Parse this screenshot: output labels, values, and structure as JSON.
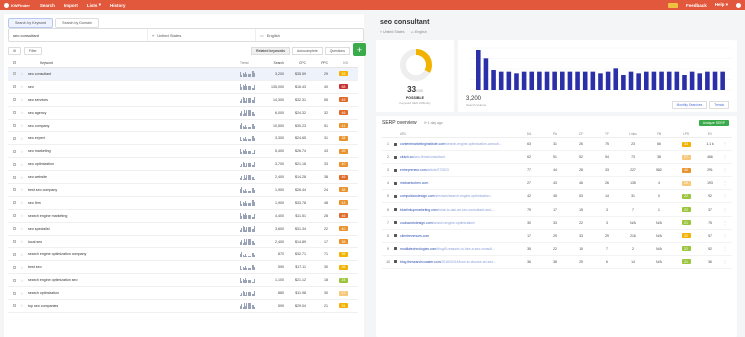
{
  "topbar": {
    "app_name": "KWFinder",
    "nav": [
      "Search",
      "Import",
      "Lists",
      "History"
    ],
    "lists_badge": "▾",
    "feedback": "Feedback",
    "help": "Help ▾"
  },
  "left": {
    "source_tabs": [
      "Search by Keyword",
      "Search by Domain"
    ],
    "keyword_value": "seo consultant",
    "location": "United States",
    "language": "English",
    "go_label": "+",
    "filter_label": "Filter",
    "kw_tabs": [
      "Related keywords",
      "Autocomplete",
      "Questions"
    ],
    "columns": {
      "keyword": "Keyword",
      "trend": "Trend",
      "search": "Search",
      "cpc": "CPC",
      "ppc": "PPC",
      "kd": "KD"
    },
    "rows": [
      {
        "kw": "seo consultant",
        "search": "3,200",
        "cpc": "$35.59",
        "ppc": "29",
        "kd": "33"
      },
      {
        "kw": "seo",
        "search": "135,000",
        "cpc": "$16.43",
        "ppc": "40",
        "kd": "58"
      },
      {
        "kw": "seo services",
        "search": "14,300",
        "cpc": "$32.31",
        "ppc": "55",
        "kd": "49"
      },
      {
        "kw": "seo agency",
        "search": "6,000",
        "cpc": "$24.32",
        "ppc": "32",
        "kd": "46"
      },
      {
        "kw": "seo company",
        "search": "10,500",
        "cpc": "$30.23",
        "ppc": "51",
        "kd": "41"
      },
      {
        "kw": "seo expert",
        "search": "3,300",
        "cpc": "$24.65",
        "ppc": "31",
        "kd": "38"
      },
      {
        "kw": "seo marketing",
        "search": "5,400",
        "cpc": "$26.74",
        "ppc": "43",
        "kd": "39"
      },
      {
        "kw": "seo optimization",
        "search": "3,700",
        "cpc": "$21.16",
        "ppc": "33",
        "kd": "40"
      },
      {
        "kw": "seo website",
        "search": "2,400",
        "cpc": "$14.28",
        "ppc": "38",
        "kd": "46"
      },
      {
        "kw": "best seo company",
        "search": "1,900",
        "cpc": "$26.44",
        "ppc": "24",
        "kd": "38"
      },
      {
        "kw": "seo firm",
        "search": "1,900",
        "cpc": "$33.78",
        "ppc": "48",
        "kd": "43"
      },
      {
        "kw": "search engine marketing",
        "search": "4,400",
        "cpc": "$11.51",
        "ppc": "28",
        "kd": "46"
      },
      {
        "kw": "seo specialist",
        "search": "3,600",
        "cpc": "$31.34",
        "ppc": "22",
        "kd": "40"
      },
      {
        "kw": "local seo",
        "search": "2,400",
        "cpc": "$14.89",
        "ppc": "17",
        "kd": "38"
      },
      {
        "kw": "search engine optimization company",
        "search": "870",
        "cpc": "$32.71",
        "ppc": "71",
        "kd": "35"
      },
      {
        "kw": "best seo",
        "search": "590",
        "cpc": "$17.11",
        "ppc": "30",
        "kd": "36"
      },
      {
        "kw": "search engine optimization seo",
        "search": "1,100",
        "cpc": "$21.12",
        "ppc": "18",
        "kd": "24"
      },
      {
        "kw": "search optimization",
        "search": "880",
        "cpc": "$11.98",
        "ppc": "30",
        "kd": "27"
      },
      {
        "kw": "top seo companies",
        "search": "590",
        "cpc": "$29.04",
        "ppc": "21",
        "kd": "31"
      }
    ]
  },
  "right": {
    "keyword_title": "seo consultant",
    "location": "United States",
    "language": "English",
    "kd_value": "33",
    "kd_max": "/100",
    "kd_label": "POSSIBLE",
    "kd_sub": "Keyword SEO Difficulty",
    "search_volume": "3,200",
    "search_volume_label": "Search Volume",
    "sv_buttons": [
      "Monthly Searches",
      "Trends"
    ],
    "sv_values": [
      96,
      76,
      48,
      44,
      44,
      40,
      44,
      44,
      44,
      44,
      44,
      44,
      44,
      44,
      44,
      44,
      40,
      44,
      52,
      36,
      44,
      40,
      44,
      44,
      44,
      44,
      44,
      36,
      44,
      40,
      44,
      44,
      44
    ],
    "serp_title": "SERP overview",
    "serp_date": "1 day ago",
    "analyze_label": "Analyze SERP",
    "serp_cols": [
      "URL",
      "DA",
      "PA",
      "CF",
      "TF",
      "Links",
      "FB",
      "LPS",
      "EV",
      ""
    ],
    "serp_rows": [
      {
        "pos": "1",
        "domain": "contentmarketinginstitute.com",
        "path": "/search-engine-optimization-consult...",
        "da": "63",
        "pa": "31",
        "cf": "26",
        "tf": "75",
        "links": "23",
        "fb": "66",
        "kd": "33",
        "ev": "1.1 k"
      },
      {
        "pos": "2",
        "domain": "clutch.co",
        "path": "/seo-firms/consultant",
        "da": "62",
        "pa": "51",
        "cf": "52",
        "tf": "54",
        "links": "73",
        "fb": "38",
        "kd": "27",
        "ev": "466"
      },
      {
        "pos": "3",
        "domain": "entrepreneur.com",
        "path": "/article/272523",
        "da": "77",
        "pa": "44",
        "cf": "28",
        "tf": "33",
        "links": "227",
        "fb": "582",
        "kd": "40",
        "ev": "291"
      },
      {
        "pos": "4",
        "domain": "michaelcohen.com",
        "path": "",
        "da": "27",
        "pa": "43",
        "cf": "46",
        "tf": "26",
        "links": "135",
        "fb": "4",
        "kd": "29",
        "ev": "193"
      },
      {
        "pos": "5",
        "domain": "compulsiondesign.com",
        "path": "/services/search-engine-optimization...",
        "da": "42",
        "pa": "45",
        "cf": "53",
        "tf": "14",
        "links": "31",
        "fb": "0",
        "kd": "22",
        "ev": "92"
      },
      {
        "pos": "6",
        "domain": "bluelinkupmarketing.com",
        "path": "/what-to-ask-an-seo-consultant-and-...",
        "da": "79",
        "pa": "17",
        "cf": "15",
        "tf": "3",
        "links": "7",
        "fb": "1",
        "kd": "22",
        "ev": "37"
      },
      {
        "pos": "7",
        "domain": "coolsworkdesign.com",
        "path": "/search-engine-optimization/",
        "da": "30",
        "pa": "33",
        "cf": "22",
        "tf": "3",
        "links": "N/A",
        "fb": "N/A",
        "kd": "21",
        "ev": "75"
      },
      {
        "pos": "8",
        "domain": "clientrevenues.com",
        "path": "",
        "da": "17",
        "pa": "29",
        "cf": "33",
        "tf": "29",
        "links": "216",
        "fb": "N/A",
        "kd": "32",
        "ev": "57"
      },
      {
        "pos": "9",
        "domain": "modliatechnologies.com",
        "path": "/blog/8-reasons-to-hire-a-seo-consult...",
        "da": "35",
        "pa": "22",
        "cf": "15",
        "tf": "7",
        "links": "2",
        "fb": "N/A",
        "kd": "22",
        "ev": "52"
      },
      {
        "pos": "10",
        "domain": "blog.thesearchcoaster.com",
        "path": "/2016/02/14/how-to-choose-an-seo...",
        "da": "36",
        "pa": "38",
        "cf": "29",
        "tf": "6",
        "links": "14",
        "fb": "N/A",
        "kd": "21",
        "ev": "36"
      }
    ]
  },
  "colors": {
    "brand": "#e2583c",
    "go": "#3aaa4a",
    "bar": "#2b2fa8",
    "kd_donut": "#f2b300"
  },
  "icons": [
    "logo-icon",
    "location-pin-icon",
    "language-flag-icon",
    "plus-icon",
    "star-icon",
    "checkbox-icon",
    "favicon-icon",
    "more-icon"
  ]
}
